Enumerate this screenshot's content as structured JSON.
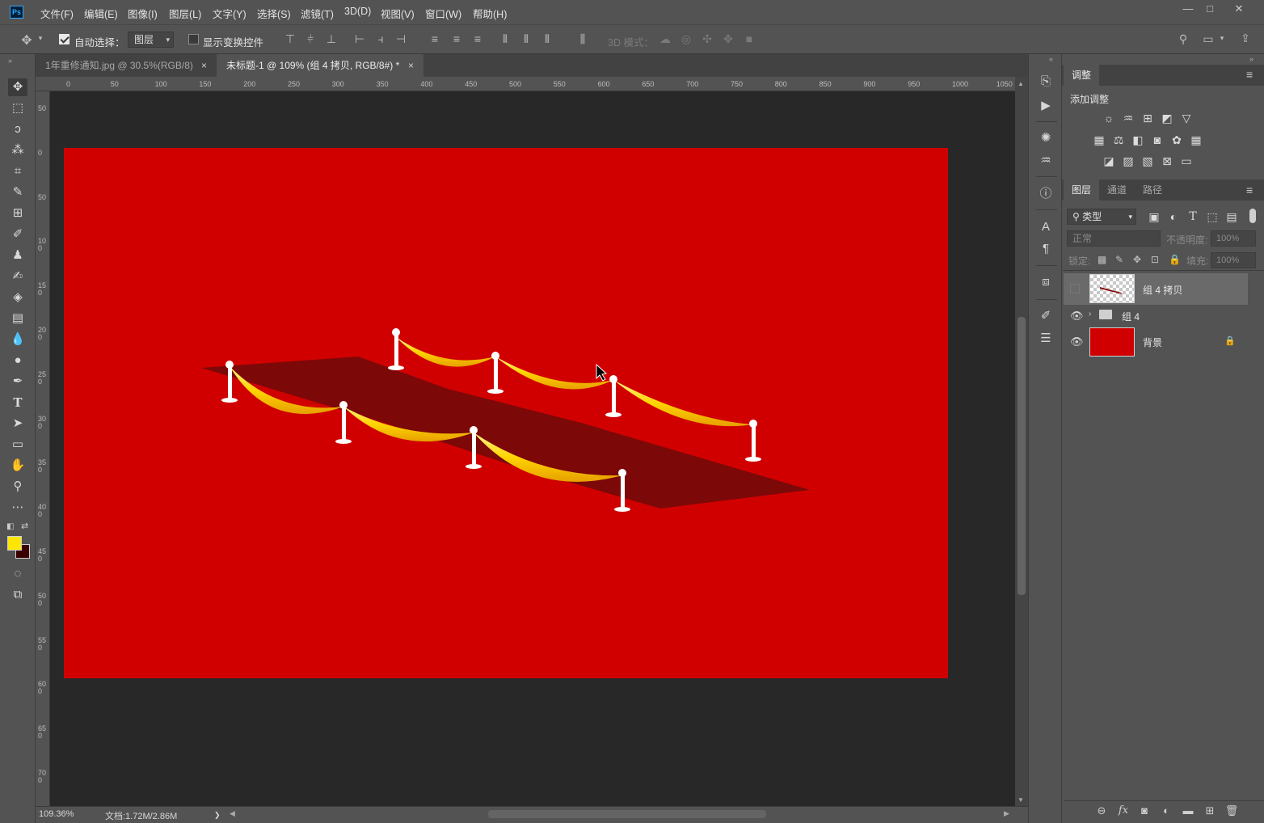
{
  "app": {
    "logo": "Ps"
  },
  "menu": [
    "文件(F)",
    "编辑(E)",
    "图像(I)",
    "图层(L)",
    "文字(Y)",
    "选择(S)",
    "滤镜(T)",
    "3D(D)",
    "视图(V)",
    "窗口(W)",
    "帮助(H)"
  ],
  "window_controls": {
    "minimize": "—",
    "restore": "□",
    "close": "✕"
  },
  "options": {
    "auto_select_label": "自动选择：",
    "auto_select_checked": true,
    "auto_select_target": "图层",
    "show_transform_label": "显示变换控件",
    "show_transform_checked": false,
    "mode_3d_label": "3D 模式："
  },
  "tabs": [
    {
      "label": "1年重修通知.jpg @ 30.5%(RGB/8)",
      "close": "×"
    },
    {
      "label": "未标题-1 @ 109% (组 4 拷贝, RGB/8#) *",
      "close": "×"
    }
  ],
  "ruler": {
    "h_ticks": [
      "0",
      "50",
      "100",
      "150",
      "200",
      "250",
      "300",
      "350",
      "400",
      "450",
      "500",
      "550",
      "600",
      "650",
      "700",
      "750",
      "800",
      "850",
      "900",
      "950",
      "1000",
      "1050"
    ],
    "v_ticks": [
      "50",
      "0",
      "50",
      "100",
      "150",
      "200",
      "250",
      "300",
      "350",
      "400",
      "450",
      "500",
      "550",
      "600",
      "650",
      "700"
    ]
  },
  "canvas": {
    "background_color": "#d10000",
    "carpet_color": "#7d0808",
    "rope_color": "#ffd400",
    "post_color": "#ffffff"
  },
  "status": {
    "zoom": "109.36%",
    "doc": "文档:1.72M/2.86M",
    "arrow": "❯"
  },
  "panels": {
    "adjustments": {
      "tab": "调整",
      "add_label": "添加调整"
    },
    "layers": {
      "tabs": [
        "图层",
        "通道",
        "路径"
      ],
      "filter_kind": "类型",
      "blend_mode": "正常",
      "opacity_label": "不透明度:",
      "opacity_value": "100%",
      "lock_label": "锁定:",
      "fill_label": "填充:",
      "fill_value": "100%",
      "items": [
        {
          "name": "组 4 拷贝",
          "visible": false,
          "selected": true,
          "kind": "layer"
        },
        {
          "name": "组 4",
          "visible": true,
          "selected": false,
          "kind": "group"
        },
        {
          "name": "背景",
          "visible": true,
          "selected": false,
          "kind": "background",
          "locked": true
        }
      ]
    }
  }
}
